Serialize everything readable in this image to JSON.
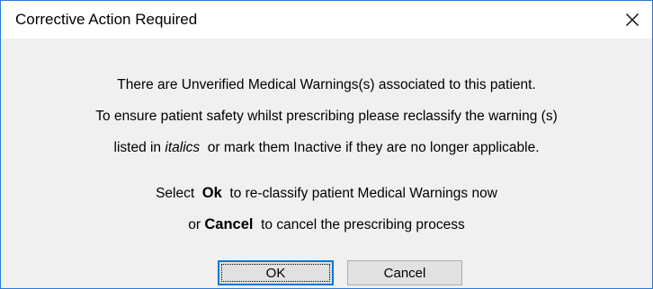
{
  "window": {
    "title": "Corrective Action Required",
    "close_icon": "close-icon"
  },
  "message": {
    "line1": "There are Unverified Medical Warnings(s) associated to this patient.",
    "line2": "To ensure patient safety whilst prescribing please reclassify the warning (s)",
    "line3_pre": "listed in ",
    "line3_italic": "italics",
    "line3_post": "  or mark them Inactive if they are no longer applicable.",
    "line4_pre": "Select  ",
    "line4_bold": "Ok",
    "line4_post": "  to re-classify patient Medical Warnings now",
    "line5_pre": "or ",
    "line5_bold": "Cancel",
    "line5_post": "  to cancel the prescribing process"
  },
  "buttons": {
    "ok_label": "OK",
    "cancel_label": "Cancel"
  },
  "colors": {
    "window_border": "#2b79d8",
    "dialog_background": "#f0f0f0",
    "titlebar_background": "#ffffff",
    "button_background": "#e1e1e1",
    "default_button_border": "#0078d7"
  }
}
